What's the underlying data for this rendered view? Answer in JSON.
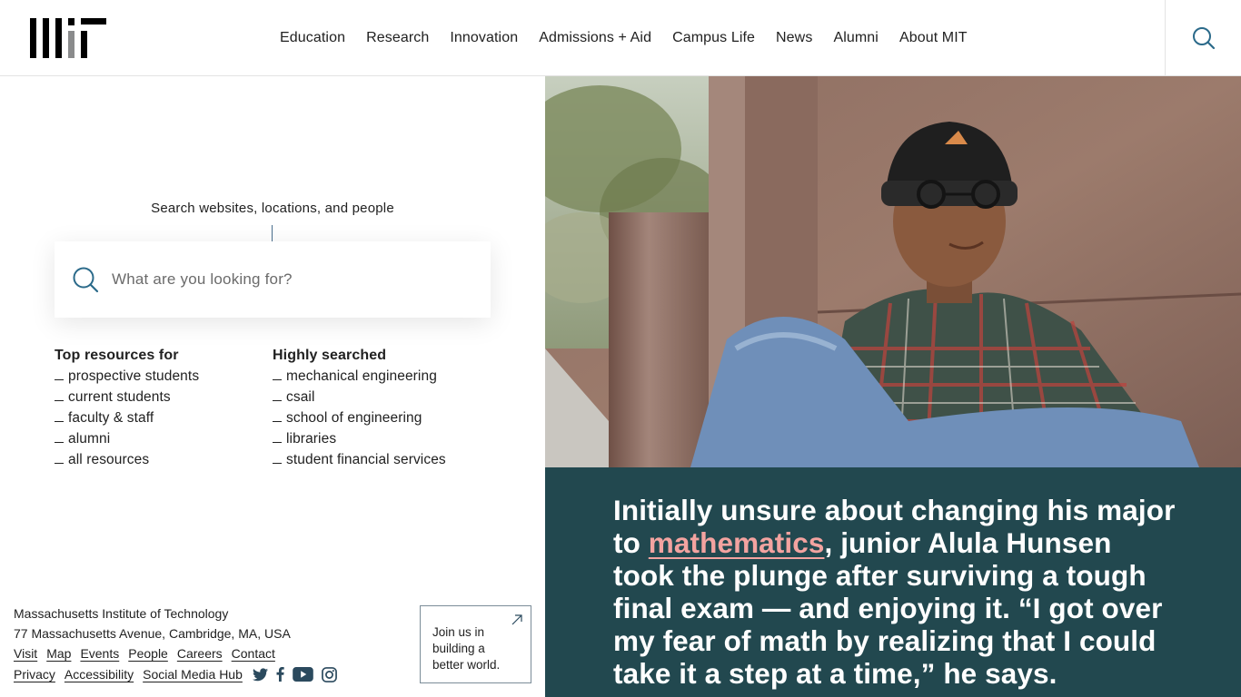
{
  "header": {
    "logo_alt": "MIT",
    "nav": [
      "Education",
      "Research",
      "Innovation",
      "Admissions + Aid",
      "Campus Life",
      "News",
      "Alumni",
      "About MIT"
    ]
  },
  "search": {
    "label": "Search websites, locations, and people",
    "placeholder": "What are you looking for?"
  },
  "resources": {
    "top": {
      "heading": "Top resources for",
      "items": [
        "prospective students",
        "current students",
        "faculty & staff",
        "alumni",
        "all resources"
      ]
    },
    "highly": {
      "heading": "Highly searched",
      "items": [
        "mechanical engineering",
        "csail",
        "school of engineering",
        "libraries",
        "student financial services"
      ]
    }
  },
  "footer": {
    "institution": "Massachusetts Institute of Technology",
    "address": "77 Massachusetts Avenue, Cambridge, MA, USA",
    "links_row1": [
      "Visit",
      "Map",
      "Events",
      "People",
      "Careers",
      "Contact"
    ],
    "links_row2": [
      "Privacy",
      "Accessibility",
      "Social Media Hub"
    ],
    "social_icons": [
      "twitter-icon",
      "facebook-icon",
      "youtube-icon",
      "instagram-icon"
    ],
    "join": [
      "Join us in",
      "building a",
      "better world."
    ]
  },
  "story": {
    "before": "Initially unsure about changing his major to ",
    "link": "mathematics",
    "after": ", junior Alula Hunsen took the plunge after surviving a tough final exam — and enjoying it. “I got over my fear of math by realizing that I could take it a step at a time,” he says."
  },
  "colors": {
    "story_bg": "#22484f",
    "story_link": "#f3a3a0",
    "logo_accent": "#8a8b8c"
  }
}
